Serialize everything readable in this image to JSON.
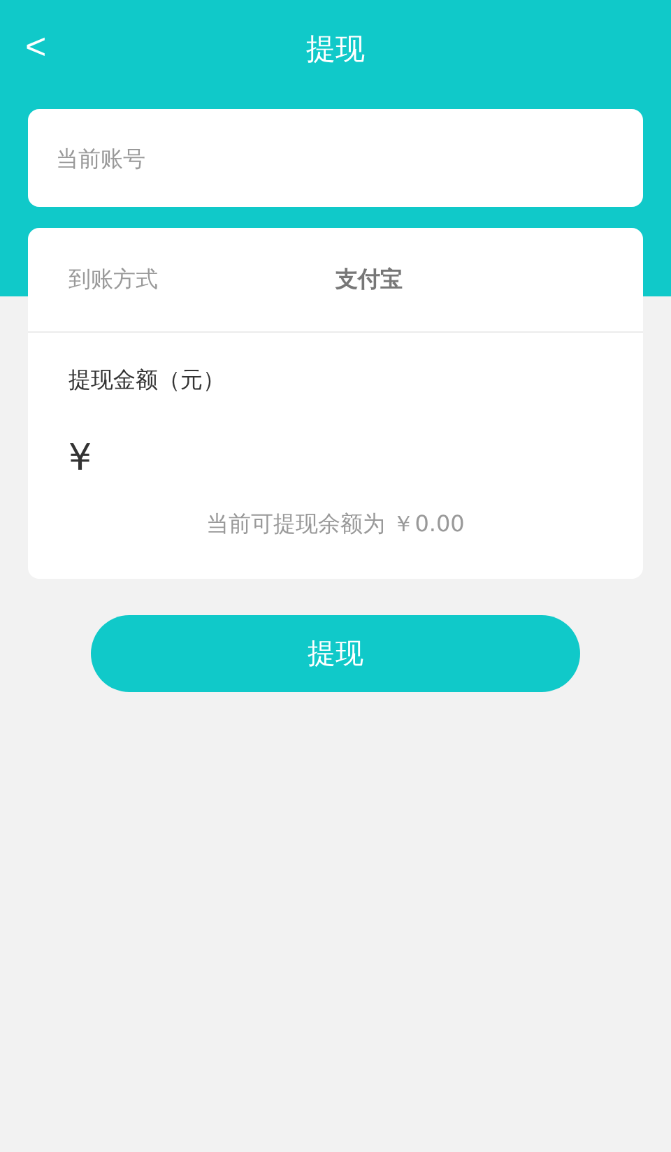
{
  "header": {
    "back": "<",
    "title": "提现"
  },
  "account": {
    "placeholder": "当前账号"
  },
  "method": {
    "label": "到账方式",
    "value": "支付宝"
  },
  "amount": {
    "label": "提现金额（元）",
    "currency": "¥",
    "balance": "当前可提现余额为 ￥0.00"
  },
  "submit": "提现"
}
